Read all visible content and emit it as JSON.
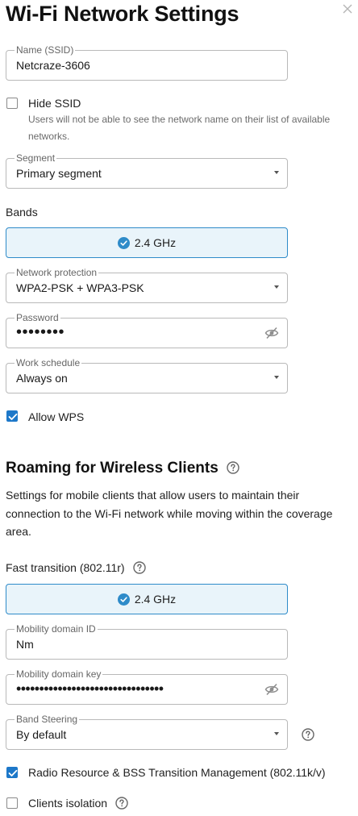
{
  "dialog": {
    "title": "Wi-Fi Network Settings"
  },
  "network": {
    "name_legend": "Name (SSID)",
    "name_value": "Netcraze-3606",
    "hide_ssid_label": "Hide SSID",
    "hide_ssid_checked": false,
    "hide_ssid_hint": "Users will not be able to see the network name on their list of available networks.",
    "segment_legend": "Segment",
    "segment_value": "Primary segment",
    "bands_label": "Bands",
    "band_value": "2.4 GHz",
    "protection_legend": "Network protection",
    "protection_value": "WPA2-PSK + WPA3-PSK",
    "password_legend": "Password",
    "password_value": "••••••••",
    "schedule_legend": "Work schedule",
    "schedule_value": "Always on",
    "wps_label": "Allow WPS",
    "wps_checked": true
  },
  "roaming": {
    "title": "Roaming for Wireless Clients",
    "description": "Settings for mobile clients that allow users to maintain their connection to the Wi-Fi network while moving within the coverage area.",
    "fast_transition_label": "Fast transition (802.11r)",
    "ft_band_value": "2.4 GHz",
    "mobility_id_legend": "Mobility domain ID",
    "mobility_id_value": "Nm",
    "mobility_key_legend": "Mobility domain key",
    "mobility_key_value": "••••••••••••••••••••••••••••••••",
    "band_steering_legend": "Band Steering",
    "band_steering_value": "By default",
    "rrm_label": "Radio Resource & BSS Transition Management (802.11k/v)",
    "rrm_checked": true,
    "isolation_label": "Clients isolation",
    "isolation_checked": false
  },
  "colors": {
    "accent": "#1d78c9",
    "band_fill": "#e9f4fa",
    "band_border": "#2e8bc9"
  }
}
